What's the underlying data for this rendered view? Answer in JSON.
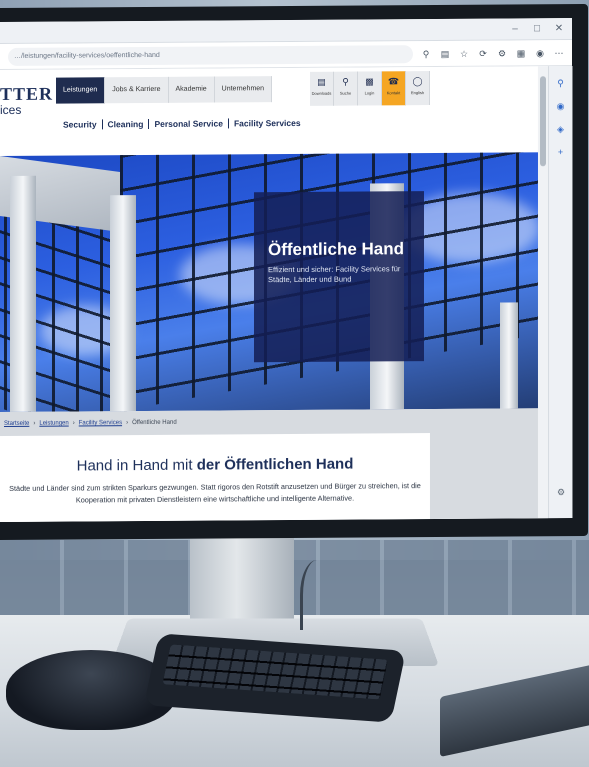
{
  "browser": {
    "url": "…/leistungen/facility-services/oeffentliche-hand"
  },
  "site": {
    "logo_main": "TTER",
    "logo_sub": "ices",
    "nav": [
      {
        "label": "Leistungen",
        "active": true
      },
      {
        "label": "Jobs & Karriere",
        "active": false
      },
      {
        "label": "Akademie",
        "active": false
      },
      {
        "label": "Unternehmen",
        "active": false
      }
    ],
    "quick_links": [
      {
        "icon": "document-icon",
        "label": "Downloads"
      },
      {
        "icon": "search-icon",
        "label": "Suche"
      },
      {
        "icon": "lock-icon",
        "label": "Login"
      },
      {
        "icon": "phone-icon",
        "label": "Kontakt"
      },
      {
        "icon": "globe-icon",
        "label": "English"
      }
    ],
    "subnav": [
      "Security",
      "Cleaning",
      "Personal Service",
      "Facility Services"
    ]
  },
  "hero": {
    "title": "Öffentliche Hand",
    "subtitle": "Effizient und sicher: Facility Services für Städte, Länder und Bund"
  },
  "breadcrumb": [
    "Startseite",
    "Leistungen",
    "Facility Services",
    "Öffentliche Hand"
  ],
  "content": {
    "heading_plain": "Hand in Hand mit ",
    "heading_bold": "der Öffentlichen Hand",
    "paragraph": "Städte und Länder sind zum strikten Sparkurs gezwungen. Statt rigoros den Rotstift anzusetzen und Bürger zu streichen, ist die Kooperation mit privaten Dienstleistern eine wirtschaftliche und intelligente Alternative."
  },
  "colors": {
    "brand_navy": "#1d2f5a",
    "accent_orange": "#f5a623",
    "hero_box": "#141e55"
  }
}
